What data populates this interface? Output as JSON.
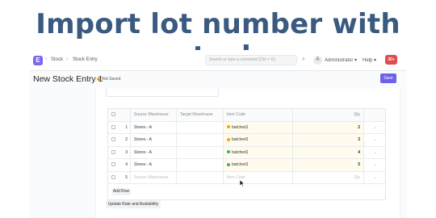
{
  "banner": {
    "title": "Import lot number with stock"
  },
  "navbar": {
    "logo": "E",
    "breadcrumbs": [
      "Stock",
      "Stock Entry"
    ],
    "search_placeholder": "Search or type a command (Ctrl + G)",
    "avatar_initial": "A",
    "user_menu": "Administrator",
    "help_menu": "Help",
    "notification_count": "30+"
  },
  "page": {
    "title": "New Stock Entry 1",
    "status": "Not Saved",
    "save_label": "Save"
  },
  "items_table": {
    "columns": [
      "Source Warehouse",
      "Target Warehouse",
      "Item Code",
      "Qty"
    ],
    "rows": [
      {
        "idx": "1",
        "source": "Stores - A",
        "target": "",
        "item": "batched1",
        "qty": "2",
        "status": "yellow"
      },
      {
        "idx": "2",
        "source": "Stores - A",
        "target": "",
        "item": "batched1",
        "qty": "3",
        "status": "yellow"
      },
      {
        "idx": "3",
        "source": "Stores - A",
        "target": "",
        "item": "batched1",
        "qty": "4",
        "status": "green"
      },
      {
        "idx": "4",
        "source": "Stores - A",
        "target": "",
        "item": "batched1",
        "qty": "5",
        "status": "green"
      }
    ],
    "empty_row": {
      "idx": "5",
      "source_placeholder": "Source Warehouse",
      "item_placeholder": "Item Code",
      "qty_placeholder": "Qty"
    },
    "add_row_label": "Add Row"
  },
  "actions": {
    "update_rate_label": "Update Rate and Availability"
  },
  "colors": {
    "accent": "#6c63e8",
    "banner_text": "#3a5a80",
    "status_yellow": "#f2a400",
    "status_green": "#3cb371"
  }
}
